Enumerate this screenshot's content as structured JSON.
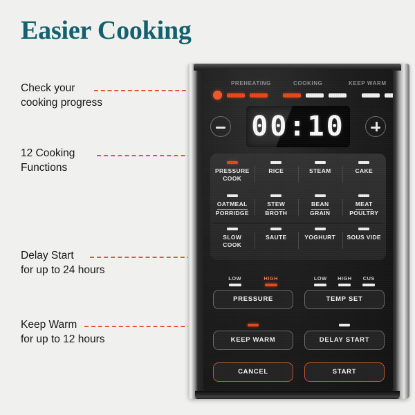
{
  "page": {
    "title": "Easier Cooking",
    "background_color": "#f0f0ef",
    "title_color": "#14606e",
    "accent_color": "#f05a28"
  },
  "callouts": [
    {
      "id": "cooking-progress",
      "text": "Check your\ncooking progress"
    },
    {
      "id": "cooking-functions",
      "text": "12 Cooking\nFunctions"
    },
    {
      "id": "delay-start",
      "text": "Delay Start\nfor up to 24 hours"
    },
    {
      "id": "keep-warm",
      "text": "Keep Warm\nfor up to 12 hours"
    }
  ],
  "device": {
    "progress": {
      "stages": [
        "PREHEATING",
        "COOKING",
        "KEEP WARM"
      ],
      "segments": [
        "dot",
        "on",
        "on",
        "gap",
        "on",
        "off",
        "off",
        "gap",
        "off",
        "off"
      ]
    },
    "display": {
      "value": "00:10",
      "decrease_label": "−",
      "increase_label": "+"
    },
    "functions": [
      {
        "label": "PRESSURE\nCOOK",
        "led": "on",
        "divided": false
      },
      {
        "label": "RICE",
        "led": "off",
        "divided": false
      },
      {
        "label": "STEAM",
        "led": "off",
        "divided": false
      },
      {
        "label": "CAKE",
        "led": "off",
        "divided": false
      },
      {
        "label": "OATMEAL|PORRIDGE",
        "led": "off",
        "divided": true
      },
      {
        "label": "STEW|BROTH",
        "led": "off",
        "divided": true
      },
      {
        "label": "BEAN|GRAIN",
        "led": "off",
        "divided": true
      },
      {
        "label": "MEAT|POULTRY",
        "led": "off",
        "divided": true
      },
      {
        "label": "SLOW\nCOOK",
        "led": "off",
        "divided": false
      },
      {
        "label": "SAUTE",
        "led": "off",
        "divided": false
      },
      {
        "label": "YOGHURT",
        "led": "off",
        "divided": false
      },
      {
        "label": "SOUS VIDE",
        "led": "off",
        "divided": false
      }
    ],
    "pressure": {
      "button_label": "PRESSURE",
      "levels": [
        {
          "label": "LOW",
          "led": "off"
        },
        {
          "label": "HIGH",
          "led": "on"
        }
      ]
    },
    "temp_set": {
      "button_label": "TEMP SET",
      "levels": [
        {
          "label": "LOW",
          "led": "off"
        },
        {
          "label": "HIGH",
          "led": "off"
        },
        {
          "label": "CUS",
          "led": "off"
        }
      ]
    },
    "keep_warm": {
      "button_label": "KEEP WARM",
      "led": "on"
    },
    "delay_start": {
      "button_label": "DELAY START",
      "led": "off"
    },
    "cancel": {
      "button_label": "CANCEL"
    },
    "start": {
      "button_label": "START"
    }
  }
}
